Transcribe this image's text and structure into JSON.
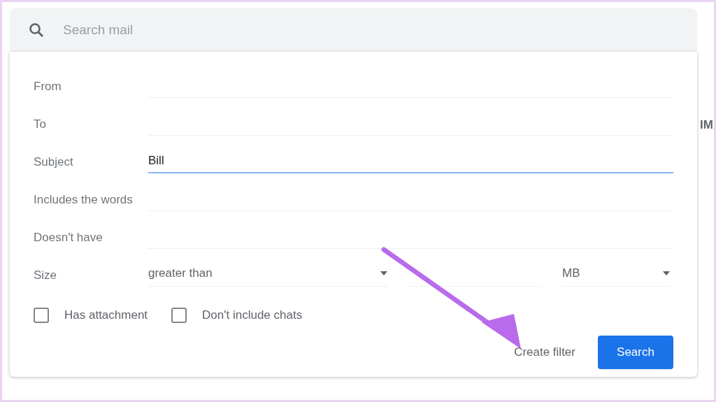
{
  "search": {
    "placeholder": "Search mail"
  },
  "fields": [
    {
      "label": "From",
      "focused": false
    },
    {
      "label": "To",
      "focused": false
    },
    {
      "label": "Subject",
      "value": "Bill",
      "focused": true
    },
    {
      "label": "Includes the words",
      "focused": false
    },
    {
      "label": "Doesn't have",
      "focused": false
    }
  ],
  "size": {
    "label": "Size",
    "comparison": "greater than",
    "unit": "MB"
  },
  "checkboxes": [
    {
      "label": "Has attachment",
      "checked": false
    },
    {
      "label": "Don't include chats",
      "checked": false
    }
  ],
  "buttons": {
    "create_filter": "Create filter",
    "search": "Search"
  },
  "background_text": "IM"
}
